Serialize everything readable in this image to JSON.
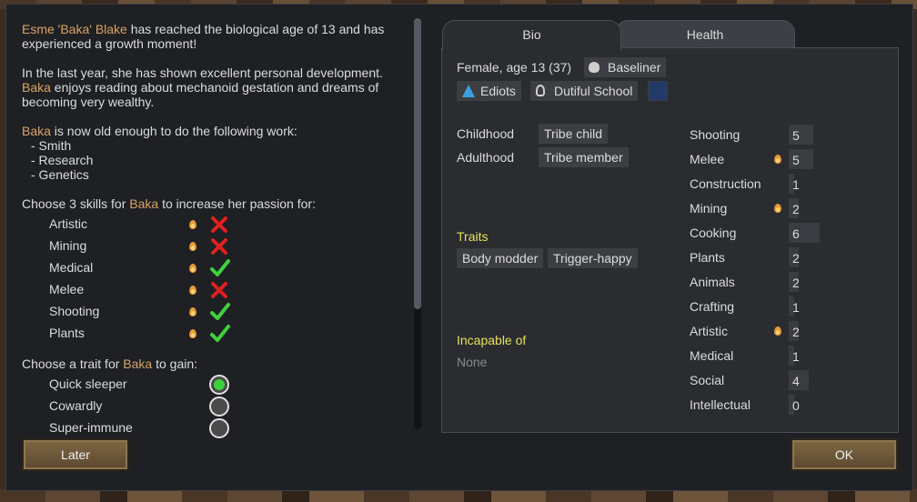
{
  "message": {
    "name_full_a": "Esme 'Baka' Blake",
    "line1_rest": " has reached the biological age of 13 and has experienced a growth moment!",
    "line2a": "In the last year, she has shown excellent personal development. ",
    "nick": "Baka",
    "line2b": " enjoys reading about mechanoid gestation and dreams of becoming very wealthy.",
    "line3b": " is now old enough to do the following work:",
    "work": [
      "- Smith",
      "- Research",
      "- Genetics"
    ],
    "skills_prompt_a": "Choose 3 skills for ",
    "skills_prompt_b": " to increase her passion for:",
    "trait_prompt_a": "Choose a trait for ",
    "trait_prompt_b": " to gain:"
  },
  "passion_skills": [
    {
      "name": "Artistic",
      "selected": false
    },
    {
      "name": "Mining",
      "selected": false
    },
    {
      "name": "Medical",
      "selected": true
    },
    {
      "name": "Melee",
      "selected": false
    },
    {
      "name": "Shooting",
      "selected": true
    },
    {
      "name": "Plants",
      "selected": true
    }
  ],
  "trait_options": [
    {
      "name": "Quick sleeper",
      "selected": true
    },
    {
      "name": "Cowardly",
      "selected": false
    },
    {
      "name": "Super-immune",
      "selected": false
    }
  ],
  "buttons": {
    "later": "Later",
    "ok": "OK"
  },
  "tabs": {
    "bio": "Bio",
    "health": "Health"
  },
  "bio": {
    "summary": "Female, age 13 (37)",
    "xenotype": "Baseliner",
    "faction": "Ediots",
    "ideo": "Dutiful School",
    "childhood_label": "Childhood",
    "childhood_value": "Tribe child",
    "adulthood_label": "Adulthood",
    "adulthood_value": "Tribe member",
    "traits_label": "Traits",
    "traits": [
      "Body modder",
      "Trigger-happy"
    ],
    "incapable_label": "Incapable of",
    "incapable_value": "None"
  },
  "skills": [
    {
      "name": "Shooting",
      "level": "5",
      "passion": false,
      "bar": 0.3
    },
    {
      "name": "Melee",
      "level": "5",
      "passion": true,
      "bar": 0.3
    },
    {
      "name": "Construction",
      "level": "1",
      "passion": false,
      "bar": 0.06
    },
    {
      "name": "Mining",
      "level": "2",
      "passion": true,
      "bar": 0.12
    },
    {
      "name": "Cooking",
      "level": "6",
      "passion": false,
      "bar": 0.38
    },
    {
      "name": "Plants",
      "level": "2",
      "passion": false,
      "bar": 0.12
    },
    {
      "name": "Animals",
      "level": "2",
      "passion": false,
      "bar": 0.12
    },
    {
      "name": "Crafting",
      "level": "1",
      "passion": false,
      "bar": 0.06
    },
    {
      "name": "Artistic",
      "level": "2",
      "passion": true,
      "bar": 0.12
    },
    {
      "name": "Medical",
      "level": "1",
      "passion": false,
      "bar": 0.06
    },
    {
      "name": "Social",
      "level": "4",
      "passion": false,
      "bar": 0.24
    },
    {
      "name": "Intellectual",
      "level": "0",
      "passion": false,
      "bar": 0.0
    }
  ],
  "colors": {
    "highlight": "#d9a364",
    "yellow_label": "#e6e05a",
    "check": "#3ed13e",
    "cross": "#e02020"
  }
}
